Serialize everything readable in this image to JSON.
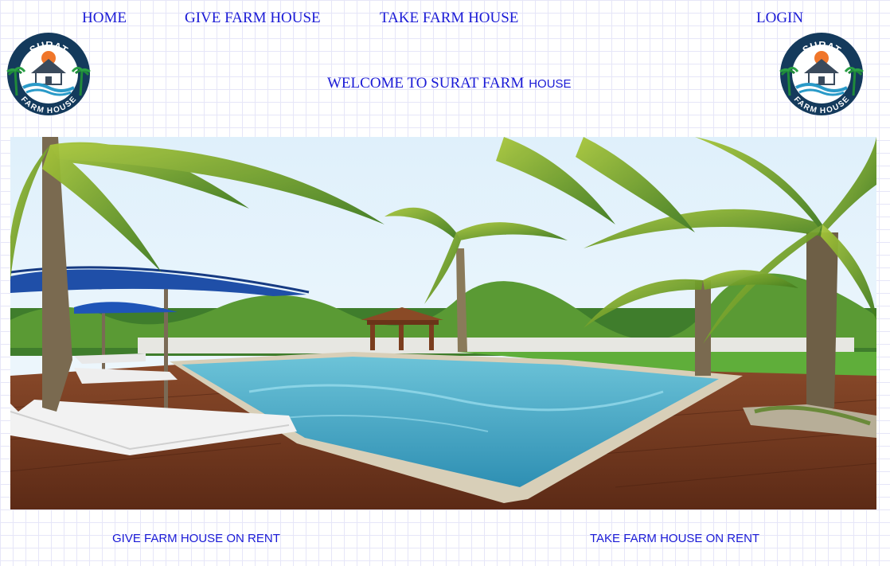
{
  "nav": {
    "home": "HOME",
    "give": "GIVE FARM HOUSE",
    "take": "TAKE FARM HOUSE",
    "login": "LOGIN"
  },
  "logo": {
    "top_text": "SURAT",
    "bottom_text": "FARM HOUSE"
  },
  "welcome": {
    "part1": "WELCOME TO SURAT FARM",
    "part2": "HOUSE"
  },
  "footer_links": {
    "give_rent": "GIVE FARM HOUSE ON RENT",
    "take_rent": "TAKE FARM HOUSE ON RENT"
  },
  "colors": {
    "link": "#1a1ad6",
    "logo_navy": "#143a5c",
    "pool": "#3fa8c4",
    "deck": "#7a3d22"
  }
}
